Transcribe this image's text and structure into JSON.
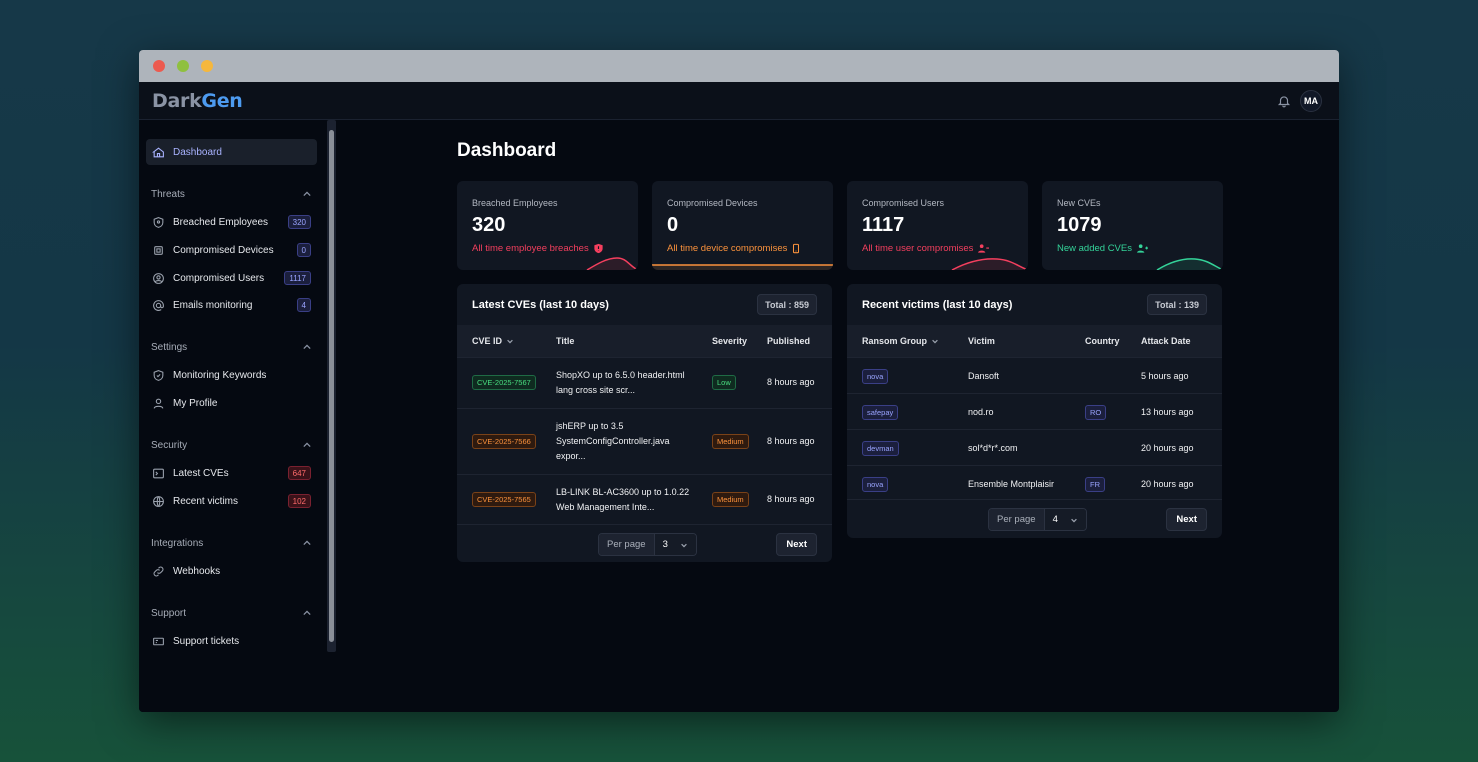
{
  "app": {
    "logo_part1": "Dark",
    "logo_part2": "Gen",
    "avatar_initials": "MA"
  },
  "sidebar": {
    "dashboard_label": "Dashboard",
    "sections": {
      "threats": "Threats",
      "settings": "Settings",
      "security": "Security",
      "integrations": "Integrations",
      "support": "Support"
    },
    "items": {
      "breached_employees": {
        "label": "Breached Employees",
        "badge": "320"
      },
      "compromised_devices": {
        "label": "Compromised Devices",
        "badge": "0"
      },
      "compromised_users": {
        "label": "Compromised Users",
        "badge": "1117"
      },
      "emails_monitoring": {
        "label": "Emails monitoring",
        "badge": "4"
      },
      "monitoring_keywords": {
        "label": "Monitoring Keywords"
      },
      "my_profile": {
        "label": "My Profile"
      },
      "latest_cves": {
        "label": "Latest CVEs",
        "badge": "647"
      },
      "recent_victims": {
        "label": "Recent victims",
        "badge": "102"
      },
      "webhooks": {
        "label": "Webhooks"
      },
      "support_tickets": {
        "label": "Support tickets"
      }
    }
  },
  "main": {
    "title": "Dashboard",
    "stats": [
      {
        "label": "Breached Employees",
        "value": "320",
        "sub": "All time employee breaches",
        "color": "#f43f5e"
      },
      {
        "label": "Compromised Devices",
        "value": "0",
        "sub": "All time device compromises",
        "color": "#fb923c"
      },
      {
        "label": "Compromised Users",
        "value": "1117",
        "sub": "All time user compromises",
        "color": "#f43f5e"
      },
      {
        "label": "New CVEs",
        "value": "1079",
        "sub": "New added CVEs",
        "color": "#34d399"
      }
    ],
    "cves": {
      "title": "Latest CVEs (last 10 days)",
      "total": "Total : 859",
      "headers": {
        "id": "CVE ID",
        "title": "Title",
        "severity": "Severity",
        "published": "Published"
      },
      "rows": [
        {
          "id": "CVE-2025-7567",
          "title_line1": "ShopXO up to 6.5.0 header.html",
          "title_line2": "lang cross site scr...",
          "severity": "Low",
          "published": "8 hours ago"
        },
        {
          "id": "CVE-2025-7566",
          "title_line1": "jshERP up to 3.5",
          "title_line2": "SystemConfigController.java",
          "title_line3": "expor...",
          "severity": "Medium",
          "published": "8 hours ago"
        },
        {
          "id": "CVE-2025-7565",
          "title_line1": "LB-LINK BL-AC3600 up to 1.0.22",
          "title_line2": "Web Management Inte...",
          "severity": "Medium",
          "published": "8 hours ago"
        }
      ],
      "per_page_label": "Per page",
      "per_page_value": "3",
      "next_label": "Next"
    },
    "victims": {
      "title": "Recent victims (last 10 days)",
      "total": "Total : 139",
      "headers": {
        "group": "Ransom Group",
        "victim": "Victim",
        "country": "Country",
        "date": "Attack Date"
      },
      "rows": [
        {
          "group": "nova",
          "victim": "Dansoft",
          "country": "",
          "date": "5 hours ago"
        },
        {
          "group": "safepay",
          "victim": "nod.ro",
          "country": "RO",
          "date": "13 hours ago"
        },
        {
          "group": "devman",
          "victim": "sol*d*r*.com",
          "country": "",
          "date": "20 hours ago"
        },
        {
          "group": "nova",
          "victim": "Ensemble Montplaisir",
          "country": "FR",
          "date": "20 hours ago"
        }
      ],
      "per_page_label": "Per page",
      "per_page_value": "4",
      "next_label": "Next"
    }
  }
}
